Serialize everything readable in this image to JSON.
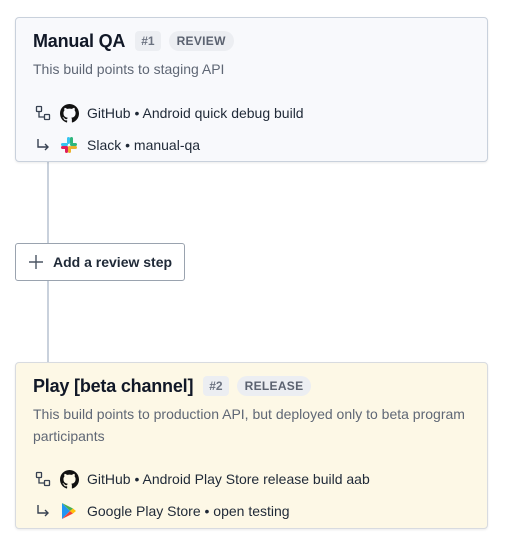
{
  "steps": [
    {
      "title": "Manual QA",
      "number": "#1",
      "type": "REVIEW",
      "description": "This build points to staging API",
      "source": {
        "icon": "github-icon",
        "text": "GitHub • Android quick debug build"
      },
      "destination": {
        "icon": "slack-icon",
        "text": "Slack • manual-qa"
      }
    },
    {
      "title": "Play [beta channel]",
      "number": "#2",
      "type": "RELEASE",
      "description": "This build points to production API, but deployed only to beta program participants",
      "source": {
        "icon": "github-icon",
        "text": "GitHub • Android Play Store release build aab"
      },
      "destination": {
        "icon": "google-play-icon",
        "text": "Google Play Store • open testing"
      }
    }
  ],
  "add_step": {
    "label": "Add a review step",
    "icon": "plus-icon"
  },
  "colors": {
    "review_card_bg": "#f8f9fc",
    "release_card_bg": "#fdf8e6",
    "border": "#c9d1dc",
    "badge_bg": "#eceef2"
  }
}
